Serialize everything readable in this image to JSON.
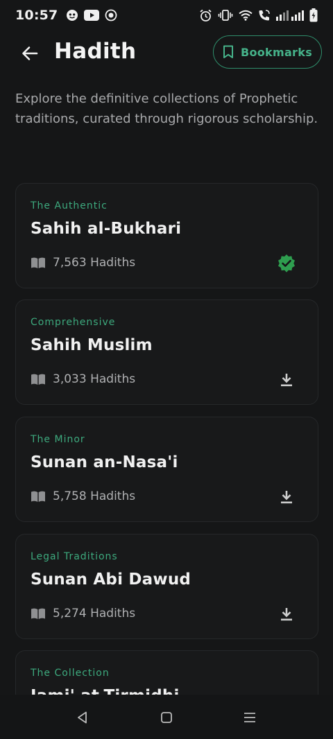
{
  "status_bar": {
    "time": "10:57"
  },
  "header": {
    "title": "Hadith",
    "bookmarks_label": "Bookmarks"
  },
  "intro": "Explore the definitive collections of Prophetic traditions, curated through rigorous scholarship.",
  "collections": [
    {
      "tag": "The Authentic",
      "title": "Sahih al-Bukhari",
      "count": "7,563 Hadiths",
      "action_icon": "verified-check-icon"
    },
    {
      "tag": "Comprehensive",
      "title": "Sahih Muslim",
      "count": "3,033 Hadiths",
      "action_icon": "download-icon"
    },
    {
      "tag": "The Minor",
      "title": "Sunan an-Nasa'i",
      "count": "5,758 Hadiths",
      "action_icon": "download-icon"
    },
    {
      "tag": "Legal Traditions",
      "title": "Sunan Abi Dawud",
      "count": "5,274 Hadiths",
      "action_icon": "download-icon"
    },
    {
      "tag": "The Collection",
      "title": "Jami' at-Tirmidhi",
      "count": "",
      "action_icon": "download-icon"
    }
  ],
  "colors": {
    "accent": "#3daa7e",
    "verified": "#2e9e4f",
    "background": "#151617",
    "card": "#18191a"
  }
}
